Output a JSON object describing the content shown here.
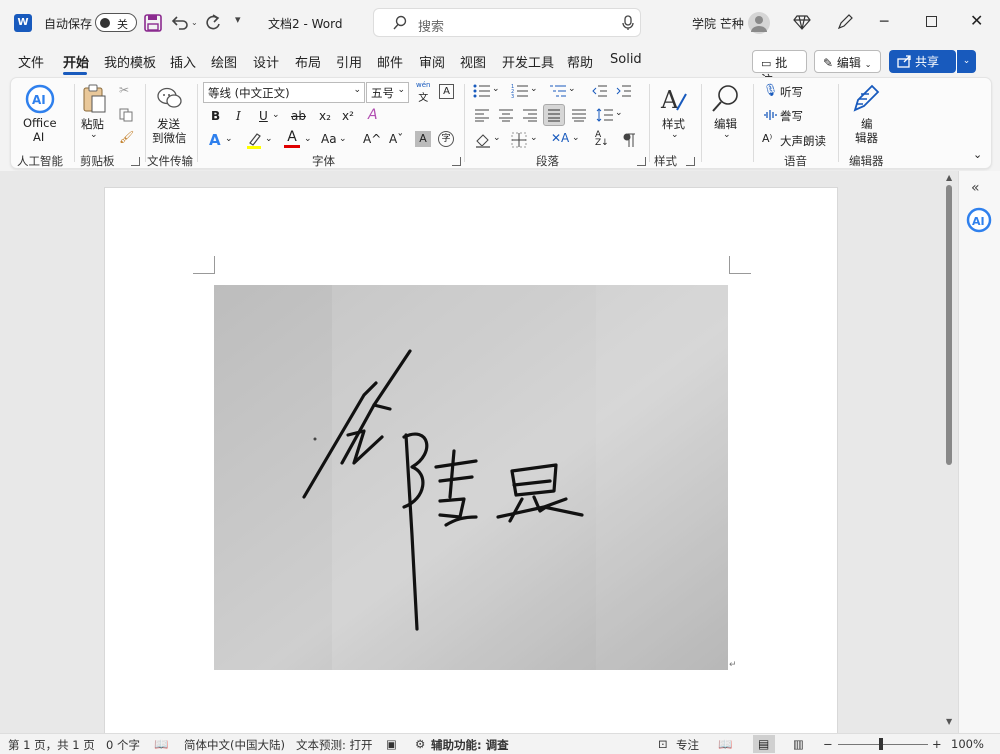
{
  "titlebar": {
    "app_icon_letter": "W",
    "autosave_label": "自动保存",
    "autosave_state": "关",
    "doc_title": "文档2 - Word",
    "search_placeholder": "搜索",
    "user_name": "学院 芒种"
  },
  "tabs": [
    "文件",
    "开始",
    "我的模板",
    "插入",
    "绘图",
    "设计",
    "布局",
    "引用",
    "邮件",
    "审阅",
    "视图",
    "开发工具",
    "帮助",
    "Solid"
  ],
  "header_buttons": {
    "comment": "批注",
    "editing": "编辑",
    "share": "共享"
  },
  "ribbon": {
    "office_ai": {
      "label_line1": "Office",
      "label_line2": "AI",
      "group": "人工智能"
    },
    "clipboard": {
      "paste": "粘贴",
      "group": "剪贴板"
    },
    "wechat": {
      "line1": "发送",
      "line2": "到微信",
      "group": "文件传输"
    },
    "font": {
      "font_name": "等线 (中文正文)",
      "font_size": "五号",
      "bold": "B",
      "italic": "I",
      "underline": "U",
      "strike": "ab",
      "subscript": "x₂",
      "superscript": "x²",
      "grow": "A^",
      "shrink": "Aˇ",
      "wen_top": "wén",
      "wen_bottom": "文",
      "group": "字体"
    },
    "paragraph": {
      "group": "段落"
    },
    "styles": {
      "label": "样式",
      "group": "样式"
    },
    "editing": {
      "label": "编辑"
    },
    "voice": {
      "dictate": "听写",
      "transcribe": "誊写",
      "read_aloud": "大声朗读",
      "group": "语音"
    },
    "editor": {
      "line1": "编",
      "line2": "辑器",
      "group": "编辑器"
    }
  },
  "statusbar": {
    "page": "第 1 页，共 1 页",
    "words": "0 个字",
    "language": "简体中文(中国大陆)",
    "prediction": "文本预测: 打开",
    "accessibility": "辅助功能: 调查",
    "focus": "专注",
    "zoom": "100%"
  },
  "colors": {
    "accent": "#185abd",
    "highlight": "#ffff00",
    "font_color": "#e00000"
  }
}
